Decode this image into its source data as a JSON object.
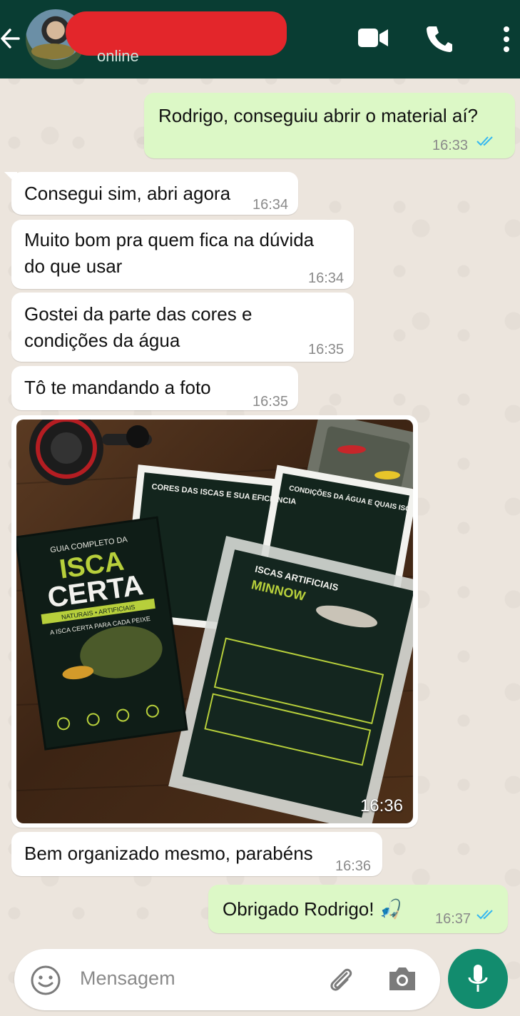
{
  "header": {
    "status": "online"
  },
  "messages": [
    {
      "direction": "out",
      "text": "Rodrigo, conseguiu abrir o material aí?",
      "time": "16:33",
      "read": true
    },
    {
      "direction": "in",
      "text": "Consegui sim, abri agora",
      "time": "16:34"
    },
    {
      "direction": "in",
      "text_line1": "Muito bom pra quem fica na dúvida",
      "text_line2": "do que usar",
      "time": "16:34"
    },
    {
      "direction": "in",
      "text_line1": "Gostei da parte das cores e",
      "text_line2": "condições da água",
      "time": "16:35"
    },
    {
      "direction": "in",
      "text": "Tô te mandando a foto",
      "time": "16:35"
    },
    {
      "direction": "in",
      "type": "image",
      "time": "16:36",
      "image_text": {
        "book_top": "GUIA COMPLETO DA",
        "book_title1": "ISCA",
        "book_title2": "CERTA",
        "book_sub": "NATURAIS • ARTIFICIAIS",
        "book_tag": "A ISCA CERTA PARA CADA PEIXE",
        "sheet1": "CORES DAS ISCAS E SUA EFICIÊNCIA",
        "sheet2": "CONDIÇÕES DA ÁGUA E QUAIS ISCAS USAR",
        "sheet3a": "ISCAS ARTIFICIAIS",
        "sheet3b": "MINNOW"
      }
    },
    {
      "direction": "in",
      "text": "Bem organizado mesmo, parabéns",
      "time": "16:36"
    },
    {
      "direction": "out",
      "text": "Obrigado Rodrigo! 🎣",
      "time": "16:37",
      "read": true
    }
  ],
  "composer": {
    "placeholder": "Mensagem"
  },
  "colors": {
    "header": "#093d33",
    "outgoing": "#dcf8c6",
    "incoming": "#ffffff",
    "read_ticks": "#34b7f1",
    "mic": "#128c6e"
  }
}
